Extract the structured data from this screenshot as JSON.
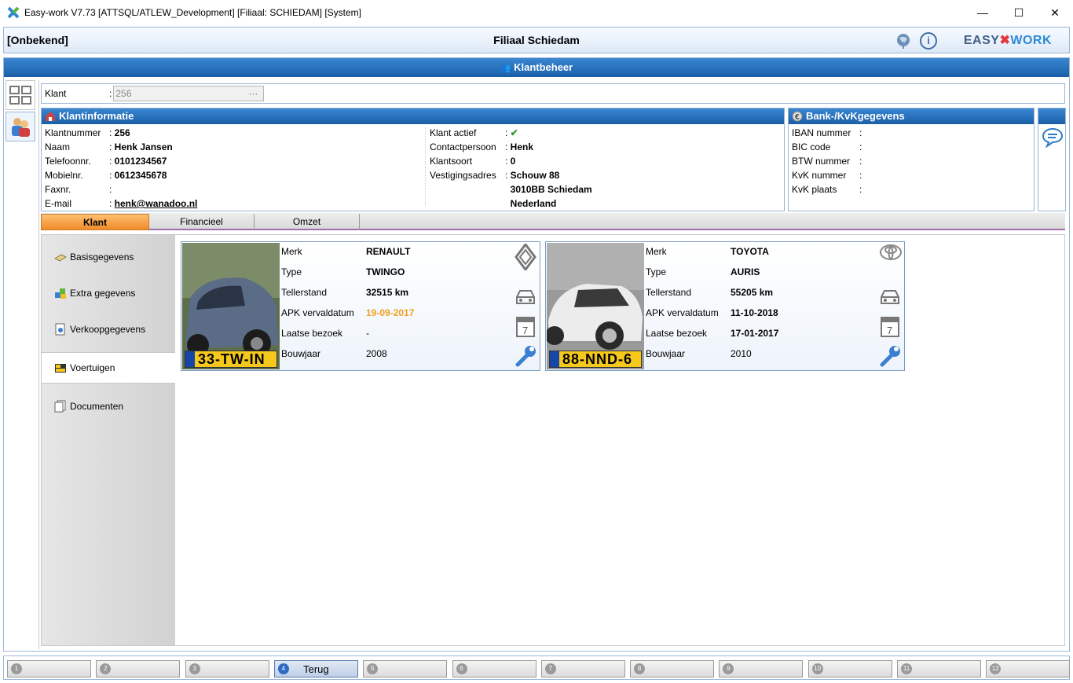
{
  "window": {
    "title": "Easy-work V7.73 [ATTSQL/ATLEW_Development] [Filiaal: SCHIEDAM] [System]",
    "minimize": "—",
    "maximize": "☐",
    "close": "✕"
  },
  "header": {
    "left": "[Onbekend]",
    "center": "Filiaal Schiedam",
    "brand_left": "EASY",
    "brand_right": "WORK",
    "info_icon": "ⓘ"
  },
  "page_title": "Klantbeheer",
  "klant": {
    "label": "Klant",
    "sep": ":",
    "value": "256",
    "ellipsis": "···"
  },
  "klantinfo": {
    "title": "Klantinformatie",
    "left": [
      {
        "k": "Klantnummer",
        "v": "256"
      },
      {
        "k": "Naam",
        "v": "Henk Jansen"
      },
      {
        "k": "Telefoonnr.",
        "v": "0101234567"
      },
      {
        "k": "Mobielnr.",
        "v": "0612345678"
      },
      {
        "k": "Faxnr.",
        "v": ""
      },
      {
        "k": "E-mail",
        "v": "henk@wanadoo.nl"
      }
    ],
    "right": [
      {
        "k": "Klant actief",
        "v": ""
      },
      {
        "k": "Contactpersoon",
        "v": "Henk"
      },
      {
        "k": "Klantsoort",
        "v": "0"
      },
      {
        "k": "Vestigingsadres",
        "v": "Schouw 88"
      },
      {
        "k": "",
        "v": "3010BB Schiedam"
      },
      {
        "k": "",
        "v": "Nederland"
      }
    ],
    "active_check": "✔"
  },
  "bank": {
    "title": "Bank-/KvKgegevens",
    "rows": [
      {
        "k": "IBAN nummer",
        "v": ""
      },
      {
        "k": "BIC code",
        "v": ""
      },
      {
        "k": "BTW nummer",
        "v": ""
      },
      {
        "k": "KvK nummer",
        "v": ""
      },
      {
        "k": "KvK plaats",
        "v": ""
      }
    ]
  },
  "tabs": [
    "Klant",
    "Financieel",
    "Omzet"
  ],
  "nav": [
    "Basisgegevens",
    "Extra gegevens",
    "Verkoopgegevens",
    "Voertuigen",
    "Documenten"
  ],
  "vehicles": [
    {
      "plate": "33-TW-IN",
      "labels": [
        "Merk",
        "Type",
        "Tellerstand",
        "APK vervaldatum",
        "Laatse bezoek",
        "Bouwjaar"
      ],
      "values": [
        "RENAULT",
        "TWINGO",
        "32515 km",
        "19-09-2017",
        "-",
        "2008"
      ],
      "apk_color": "#f0a020"
    },
    {
      "plate": "88-NND-6",
      "labels": [
        "Merk",
        "Type",
        "Tellerstand",
        "APK vervaldatum",
        "Laatse bezoek",
        "Bouwjaar"
      ],
      "values": [
        "TOYOTA",
        "AURIS",
        "55205 km",
        "11-10-2018",
        "17-01-2017",
        "2010"
      ],
      "apk_color": "#000000"
    }
  ],
  "calendar_day": "7",
  "footer": [
    {
      "n": "1",
      "label": ""
    },
    {
      "n": "2",
      "label": ""
    },
    {
      "n": "3",
      "label": ""
    },
    {
      "n": "4",
      "label": "Terug"
    },
    {
      "n": "5",
      "label": ""
    },
    {
      "n": "6",
      "label": ""
    },
    {
      "n": "7",
      "label": ""
    },
    {
      "n": "8",
      "label": ""
    },
    {
      "n": "9",
      "label": ""
    },
    {
      "n": "10",
      "label": ""
    },
    {
      "n": "11",
      "label": ""
    },
    {
      "n": "12",
      "label": ""
    }
  ]
}
